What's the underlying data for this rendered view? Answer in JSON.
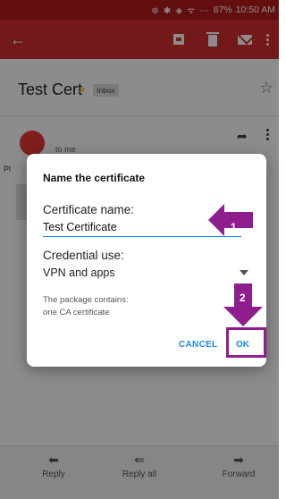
{
  "status_bar": {
    "icons": "⊕ ✱ ◈ ᯤ ⋯",
    "battery": "87%",
    "time": "10:50 AM"
  },
  "toolbar": {
    "back_icon": "arrow-left-icon",
    "actions": [
      "archive-icon",
      "trash-icon",
      "mail-icon",
      "overflow-menu-icon"
    ]
  },
  "email": {
    "subject": "Test Cert",
    "label": "Inbox",
    "recipient": "to me",
    "body_fragment": "Pl"
  },
  "dialog": {
    "title": "Name the certificate",
    "name_label": "Certificate name:",
    "name_value": "Test Certificate",
    "use_label": "Credential use:",
    "use_value": "VPN and apps",
    "info_line1": "The package contains:",
    "info_line2": "one CA certificate",
    "cancel_label": "CANCEL",
    "ok_label": "OK"
  },
  "annotations": {
    "step1": "1",
    "step2": "2",
    "color": "#8e1e8e"
  },
  "footer": {
    "reply": "Reply",
    "reply_all": "Reply all",
    "forward": "Forward"
  },
  "colors": {
    "status_bar": "#b71c1c",
    "toolbar": "#d32f2f",
    "accent": "#1e88e5",
    "avatar": "#e53935"
  }
}
